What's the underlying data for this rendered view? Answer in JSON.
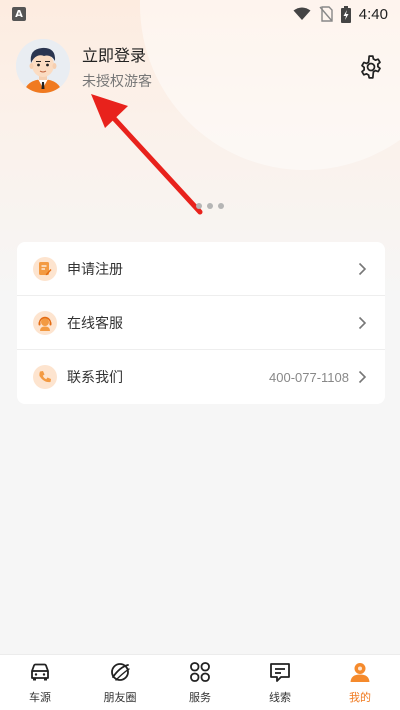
{
  "status_bar": {
    "left_badge": "A",
    "time": "4:40",
    "icons": [
      "wifi-icon",
      "sim-off-icon",
      "battery-charging-icon"
    ]
  },
  "profile": {
    "title": "立即登录",
    "subtitle": "未授权游客",
    "avatar_icon": "avatar-icon",
    "settings_icon": "gear-icon"
  },
  "carousel": {
    "dots": 3
  },
  "menu": {
    "items": [
      {
        "label": "申请注册",
        "icon": "register-form-icon",
        "value": ""
      },
      {
        "label": "在线客服",
        "icon": "customer-service-icon",
        "value": ""
      },
      {
        "label": "联系我们",
        "icon": "phone-icon",
        "value": "400-077-1108"
      }
    ]
  },
  "tabbar": {
    "tabs": [
      {
        "label": "车源",
        "icon": "car-icon",
        "active": false
      },
      {
        "label": "朋友圈",
        "icon": "planet-icon",
        "active": false
      },
      {
        "label": "服务",
        "icon": "grid-icon",
        "active": false
      },
      {
        "label": "线索",
        "icon": "message-icon",
        "active": false
      },
      {
        "label": "我的",
        "icon": "user-icon",
        "active": true
      }
    ]
  },
  "colors": {
    "accent": "#f07a20",
    "icon_bg": "#fde4cf",
    "arrow": "#e8221c"
  }
}
